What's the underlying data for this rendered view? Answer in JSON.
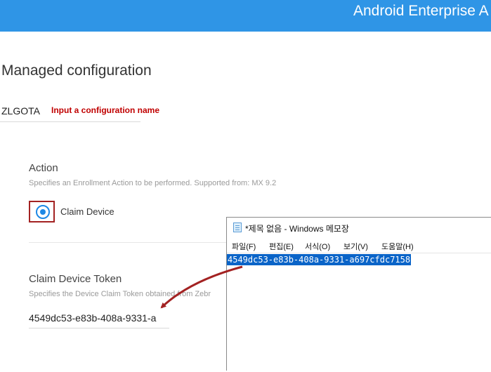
{
  "header": {
    "title": "Android Enterprise A"
  },
  "page": {
    "title": "Managed configuration"
  },
  "config_name": {
    "value": "ZLGOTA",
    "hint": "Input a configuration name"
  },
  "action": {
    "label": "Action",
    "description": "Specifies an Enrollment Action to be performed. Supported from: MX 9.2",
    "option_label": "Claim Device",
    "selected": true
  },
  "token": {
    "label": "Claim Device Token",
    "description": "Specifies the Device Claim Token obtained from Zebr",
    "value": "4549dc53-e83b-408a-9331-a"
  },
  "notepad": {
    "title": "*제목 없음 - Windows 메모장",
    "menu": [
      "파일(F)",
      "편집(E)",
      "서식(O)",
      "보기(V)",
      "도움말(H)"
    ],
    "selected_text": "4549dc53-e83b-408a-9331-a697cfdc7158"
  },
  "colors": {
    "header": "#2f95e6",
    "accent": "#1e88e5",
    "hint": "#c00000",
    "annotation": "#a32222",
    "selection": "#0a64c8"
  }
}
